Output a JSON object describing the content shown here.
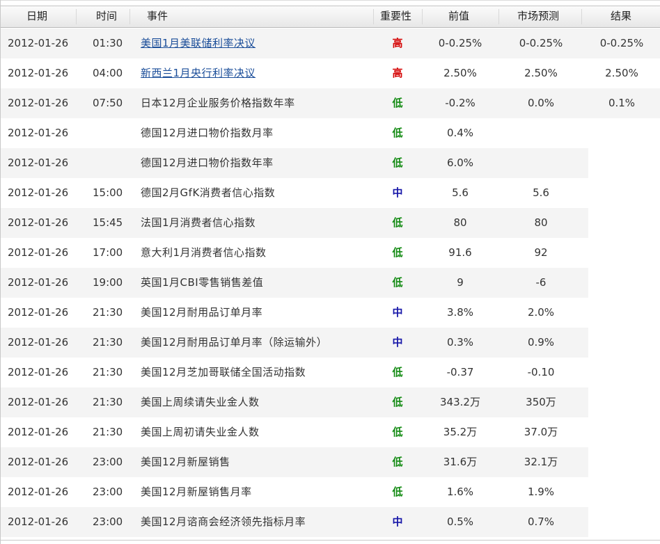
{
  "header": {
    "date": "日期",
    "time": "时间",
    "event": "事件",
    "importance": "重要性",
    "previous": "前值",
    "forecast": "市场预测",
    "result": "结果"
  },
  "colors": {
    "high": "#d40000",
    "mid": "#1616a8",
    "low": "#128a12",
    "link": "#1a4d99"
  },
  "rows": [
    {
      "date": "2012-01-26",
      "time": "01:30",
      "event": "美国1月美联储利率决议",
      "link": true,
      "importance": "高",
      "level": "high",
      "previous": "0-0.25%",
      "forecast": "0-0.25%",
      "result": "0-0.25%"
    },
    {
      "date": "2012-01-26",
      "time": "04:00",
      "event": "新西兰1月央行利率决议",
      "link": true,
      "importance": "高",
      "level": "high",
      "previous": "2.50%",
      "forecast": "2.50%",
      "result": "2.50%"
    },
    {
      "date": "2012-01-26",
      "time": "07:50",
      "event": "日本12月企业服务价格指数年率",
      "link": false,
      "importance": "低",
      "level": "low",
      "previous": "-0.2%",
      "forecast": "0.0%",
      "result": "0.1%"
    },
    {
      "date": "2012-01-26",
      "time": "",
      "event": "德国12月进口物价指数月率",
      "link": false,
      "importance": "低",
      "level": "low",
      "previous": "0.4%",
      "forecast": "",
      "result": ""
    },
    {
      "date": "2012-01-26",
      "time": "",
      "event": "德国12月进口物价指数年率",
      "link": false,
      "importance": "低",
      "level": "low",
      "previous": "6.0%",
      "forecast": "",
      "result": ""
    },
    {
      "date": "2012-01-26",
      "time": "15:00",
      "event": "德国2月GfK消费者信心指数",
      "link": false,
      "importance": "中",
      "level": "mid",
      "previous": "5.6",
      "forecast": "5.6",
      "result": ""
    },
    {
      "date": "2012-01-26",
      "time": "15:45",
      "event": "法国1月消费者信心指数",
      "link": false,
      "importance": "低",
      "level": "low",
      "previous": "80",
      "forecast": "80",
      "result": ""
    },
    {
      "date": "2012-01-26",
      "time": "17:00",
      "event": "意大利1月消费者信心指数",
      "link": false,
      "importance": "低",
      "level": "low",
      "previous": "91.6",
      "forecast": "92",
      "result": ""
    },
    {
      "date": "2012-01-26",
      "time": "19:00",
      "event": "英国1月CBI零售销售差值",
      "link": false,
      "importance": "低",
      "level": "low",
      "previous": "9",
      "forecast": "-6",
      "result": ""
    },
    {
      "date": "2012-01-26",
      "time": "21:30",
      "event": "美国12月耐用品订单月率",
      "link": false,
      "importance": "中",
      "level": "mid",
      "previous": "3.8%",
      "forecast": "2.0%",
      "result": ""
    },
    {
      "date": "2012-01-26",
      "time": "21:30",
      "event": "美国12月耐用品订单月率（除运输外）",
      "link": false,
      "importance": "中",
      "level": "mid",
      "previous": "0.3%",
      "forecast": "0.9%",
      "result": ""
    },
    {
      "date": "2012-01-26",
      "time": "21:30",
      "event": "美国12月芝加哥联储全国活动指数",
      "link": false,
      "importance": "低",
      "level": "low",
      "previous": "-0.37",
      "forecast": "-0.10",
      "result": ""
    },
    {
      "date": "2012-01-26",
      "time": "21:30",
      "event": "美国上周续请失业金人数",
      "link": false,
      "importance": "低",
      "level": "low",
      "previous": "343.2万",
      "forecast": "350万",
      "result": ""
    },
    {
      "date": "2012-01-26",
      "time": "21:30",
      "event": "美国上周初请失业金人数",
      "link": false,
      "importance": "低",
      "level": "low",
      "previous": "35.2万",
      "forecast": "37.0万",
      "result": ""
    },
    {
      "date": "2012-01-26",
      "time": "23:00",
      "event": "美国12月新屋销售",
      "link": false,
      "importance": "低",
      "level": "low",
      "previous": "31.6万",
      "forecast": "32.1万",
      "result": ""
    },
    {
      "date": "2012-01-26",
      "time": "23:00",
      "event": "美国12月新屋销售月率",
      "link": false,
      "importance": "低",
      "level": "low",
      "previous": "1.6%",
      "forecast": "1.9%",
      "result": ""
    },
    {
      "date": "2012-01-26",
      "time": "23:00",
      "event": "美国12月谘商会经济领先指标月率",
      "link": false,
      "importance": "中",
      "level": "mid",
      "previous": "0.5%",
      "forecast": "0.7%",
      "result": ""
    }
  ]
}
